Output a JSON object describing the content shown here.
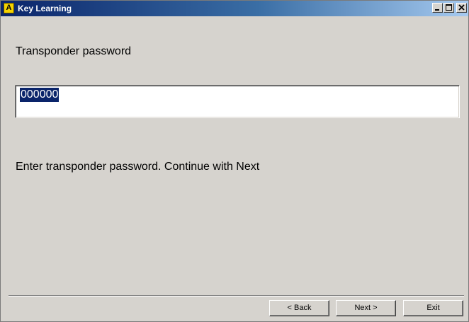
{
  "window": {
    "title": "Key Learning",
    "icon_letter": "A",
    "icon_name": "app-icon",
    "title_gradient": [
      "#0a246a",
      "#a6caf0"
    ],
    "background": "#d6d3ce"
  },
  "controls": {
    "minimize_icon": "minimize-icon",
    "maximize_icon": "maximize-icon",
    "close_icon": "close-icon"
  },
  "form": {
    "heading": "Transponder password",
    "password_value": "000000",
    "selection_color": "#0a246a",
    "instruction": "Enter transponder password. Continue with Next"
  },
  "buttons": {
    "back": "< Back",
    "next": "Next >",
    "exit": "Exit"
  }
}
